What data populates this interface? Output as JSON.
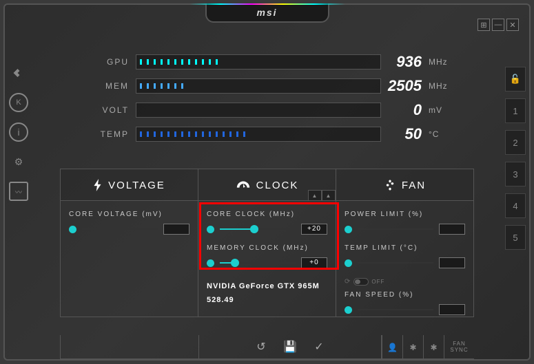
{
  "brand": "msi",
  "stats": {
    "gpu": {
      "label": "GPU",
      "value": "936",
      "unit": "MHz"
    },
    "mem": {
      "label": "MEM",
      "value": "2505",
      "unit": "MHz"
    },
    "volt": {
      "label": "VOLT",
      "value": "0",
      "unit": "mV"
    },
    "temp": {
      "label": "TEMP",
      "value": "50",
      "unit": "°C"
    }
  },
  "tabs": {
    "voltage": "VOLTAGE",
    "clock": "CLOCK",
    "fan": "FAN"
  },
  "controls": {
    "core_voltage_label": "CORE VOLTAGE (mV)",
    "core_clock_label": "CORE CLOCK (MHz)",
    "memory_clock_label": "MEMORY CLOCK (MHz)",
    "power_limit_label": "POWER LIMIT (%)",
    "temp_limit_label": "TEMP LIMIT (°C)",
    "fan_speed_label": "FAN SPEED (%)",
    "core_clock_value": "+20",
    "memory_clock_value": "+0",
    "core_voltage_value": "",
    "power_limit_value": "",
    "temp_limit_value": "",
    "fan_speed_value": "",
    "fan_toggle_label": "OFF"
  },
  "gpu": {
    "name": "NVIDIA GeForce GTX 965M",
    "version": "528.49"
  },
  "profiles": [
    "1",
    "2",
    "3",
    "4",
    "5"
  ],
  "footer": {
    "fan_sync": "FAN SYNC"
  },
  "icons": {
    "lock": "🔓",
    "profile": "👤",
    "fan_icon": "✱"
  }
}
